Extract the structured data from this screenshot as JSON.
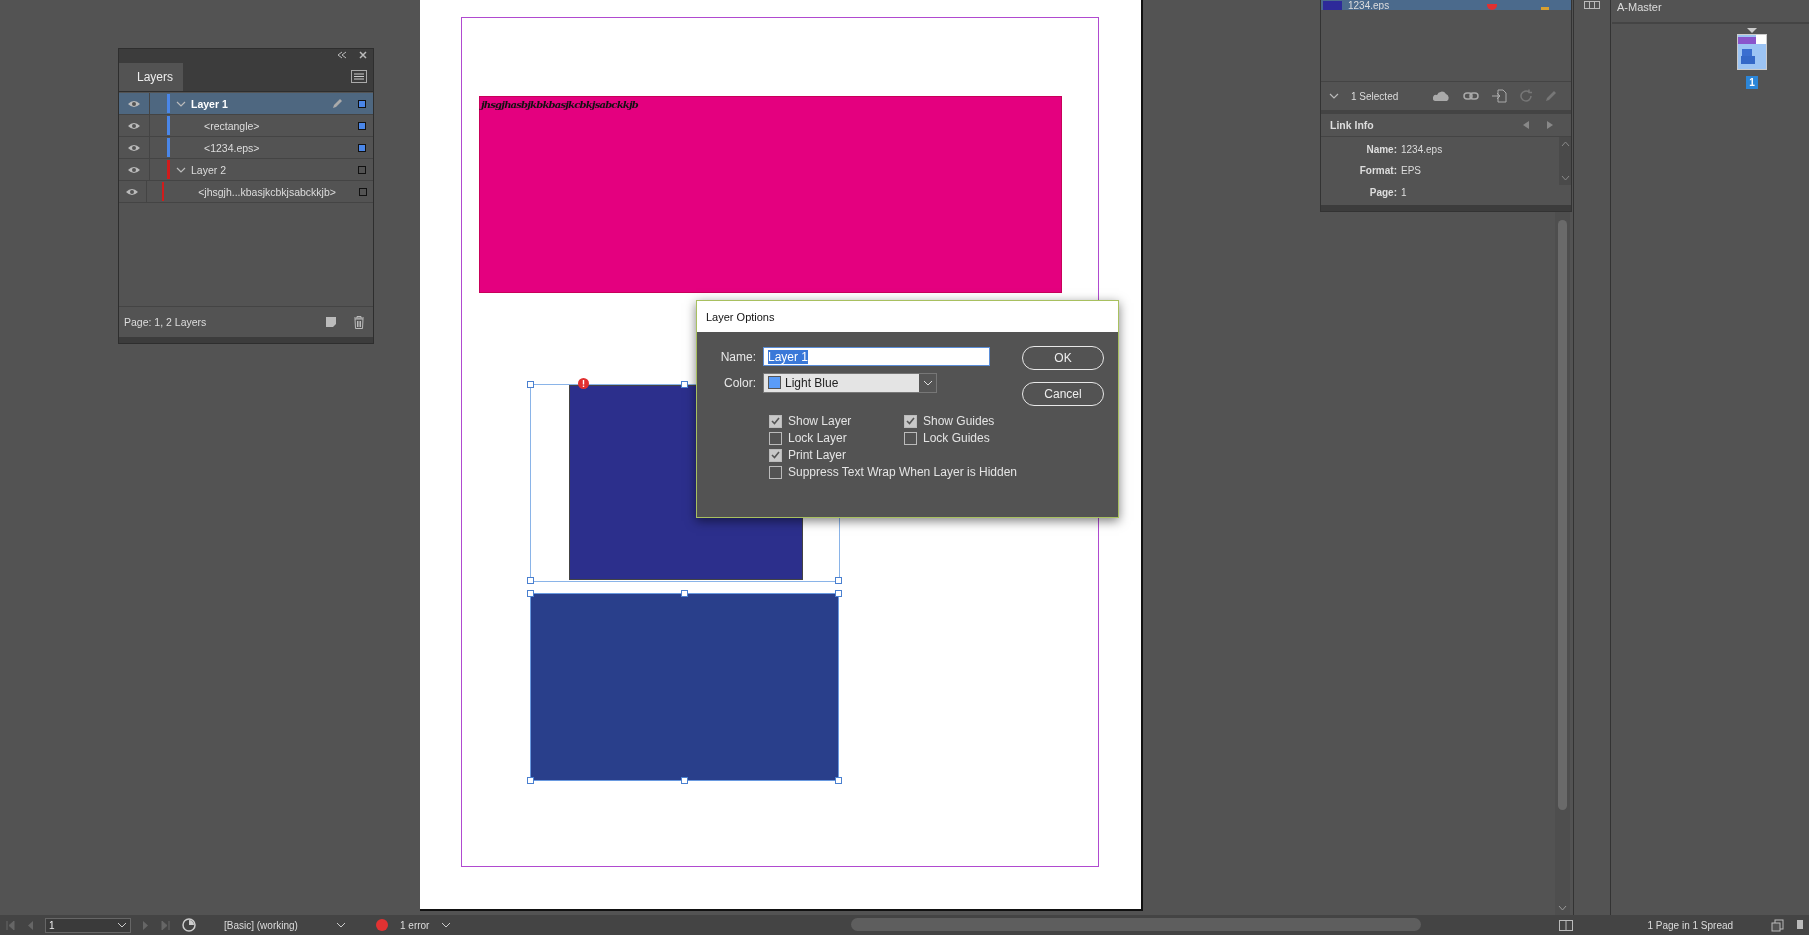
{
  "layers_panel": {
    "tab": "Layers",
    "footer": "Page: 1, 2 Layers",
    "layers": [
      {
        "name": "Layer 1",
        "color": "#4a86e8",
        "active": true,
        "expanded": true,
        "visible": true,
        "selected": true,
        "children": [
          {
            "name": "<rectangle>",
            "visible": true,
            "selected": true
          },
          {
            "name": "<1234.eps>",
            "visible": true,
            "selected": true
          }
        ]
      },
      {
        "name": "Layer 2",
        "color": "#d01c1c",
        "active": false,
        "expanded": true,
        "visible": true,
        "selected": false,
        "children": [
          {
            "name": "<jhsgjh...kbasjkcbkjsabckkjb>",
            "visible": true,
            "selected": false
          }
        ]
      }
    ]
  },
  "links_panel": {
    "link": {
      "name": "1234.eps",
      "selected": true
    },
    "selection": "1 Selected",
    "info_title": "Link Info",
    "info": [
      {
        "label": "Name:",
        "value": "1234.eps"
      },
      {
        "label": "Format:",
        "value": "EPS"
      },
      {
        "label": "Page:",
        "value": "1"
      }
    ]
  },
  "pages_panel": {
    "master": "A-Master",
    "page_number": "1",
    "summary": "1 Page in 1 Spread"
  },
  "canvas": {
    "text_frame": "jhsgjhasbjkbkbasjkcbkjsabckkjb"
  },
  "dialog": {
    "title": "Layer Options",
    "name_label": "Name:",
    "name_value": "Layer 1",
    "color_label": "Color:",
    "color_value": "Light Blue",
    "color": "#5a9cf8",
    "options": [
      {
        "label": "Show Layer",
        "checked": true
      },
      {
        "label": "Show Guides",
        "checked": true
      },
      {
        "label": "Lock Layer",
        "checked": false
      },
      {
        "label": "Lock Guides",
        "checked": false
      },
      {
        "label": "Print Layer",
        "checked": true
      },
      {
        "label": "Suppress Text Wrap When Layer is Hidden",
        "checked": false
      }
    ],
    "buttons": [
      "OK",
      "Cancel"
    ]
  },
  "status_bar": {
    "page": "1",
    "profile": "[Basic] (working)",
    "errors": "1 error"
  }
}
